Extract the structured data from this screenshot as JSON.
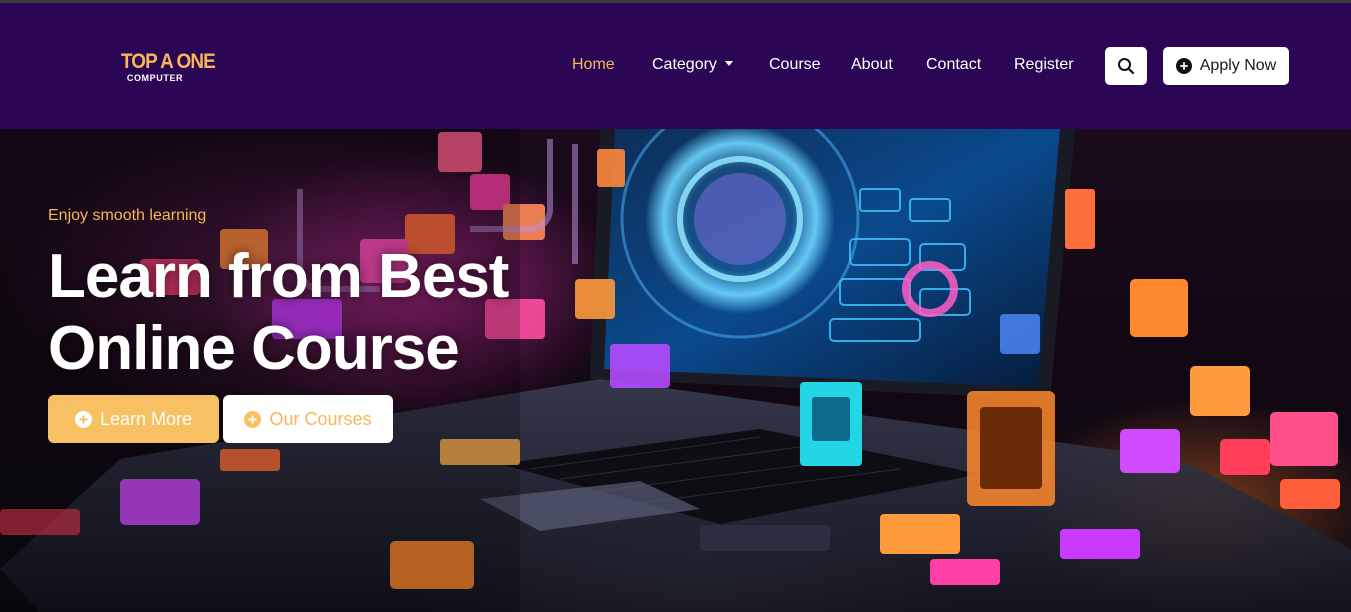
{
  "brand": {
    "logo_main": "TOP A ONE",
    "logo_sub": "COMPUTER",
    "accent_color": "#f6b75a",
    "nav_bg_color": "#2b0654"
  },
  "nav": {
    "links": [
      {
        "label": "Home",
        "active": true
      },
      {
        "label": "Category",
        "dropdown": true
      },
      {
        "label": "Course"
      },
      {
        "label": "About"
      },
      {
        "label": "Contact"
      },
      {
        "label": "Register"
      }
    ],
    "search_icon": "search-icon",
    "apply_label": "Apply Now",
    "apply_icon": "plus-circle-icon"
  },
  "hero": {
    "tagline": "Enjoy smooth learning",
    "headline_line1": "Learn from Best",
    "headline_line2": "Online Course",
    "primary_button": "Learn More",
    "secondary_button": "Our Courses",
    "button_icon": "plus-circle-icon"
  }
}
